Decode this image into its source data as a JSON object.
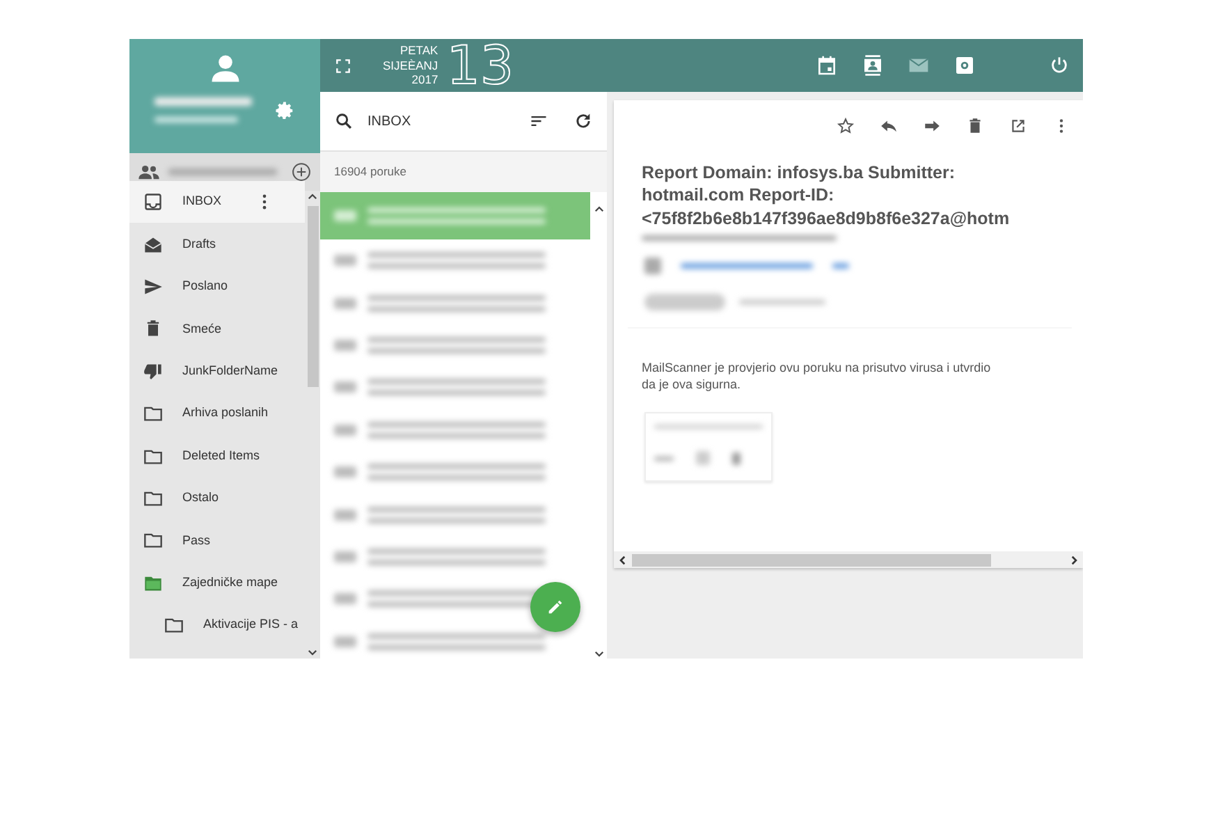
{
  "date": {
    "weekday": "PETAK",
    "month": "SIJEÈANJ",
    "year": "2017",
    "day": "13"
  },
  "apps": [
    {
      "kind": "calendar",
      "selected": false
    },
    {
      "kind": "contacts",
      "selected": false
    },
    {
      "kind": "mail",
      "selected": true
    },
    {
      "kind": "settings",
      "selected": false
    }
  ],
  "folder_bar": {
    "title": "INBOX",
    "count": "16904 poruke"
  },
  "folders": [
    {
      "kind": "inbox",
      "label": "INBOX",
      "selected": true
    },
    {
      "kind": "drafts",
      "label": "Drafts",
      "selected": false
    },
    {
      "kind": "sent",
      "label": "Poslano",
      "selected": false
    },
    {
      "kind": "trash",
      "label": "Smeće",
      "selected": false
    },
    {
      "kind": "junk",
      "label": "JunkFolderName",
      "selected": false
    },
    {
      "kind": "folder",
      "label": "Arhiva poslanih",
      "selected": false
    },
    {
      "kind": "folder",
      "label": "Deleted Items",
      "selected": false
    },
    {
      "kind": "folder",
      "label": "Ostalo",
      "selected": false
    },
    {
      "kind": "folder",
      "label": "Pass",
      "selected": false
    },
    {
      "kind": "shared",
      "label": "Zajedničke mape",
      "selected": false,
      "children": [
        {
          "kind": "folder",
          "label": "Aktivacije PIS - a",
          "selected": false
        }
      ]
    }
  ],
  "messages": [
    {
      "selected": true
    },
    {
      "selected": false
    },
    {
      "selected": false
    },
    {
      "selected": false
    },
    {
      "selected": false
    },
    {
      "selected": false
    },
    {
      "selected": false
    },
    {
      "selected": false
    },
    {
      "selected": false
    },
    {
      "selected": false
    },
    {
      "selected": false
    }
  ],
  "message": {
    "subject_lines": [
      "Report Domain: infosys.ba Submitter:",
      "hotmail.com Report-ID:",
      "<75f8f2b6e8b147f396ae8d9b8f6e327a@hotm"
    ],
    "body": "MailScanner je provjerio ovu poruku na prisutvo virusa i utvrdio da je ova sigurna."
  }
}
